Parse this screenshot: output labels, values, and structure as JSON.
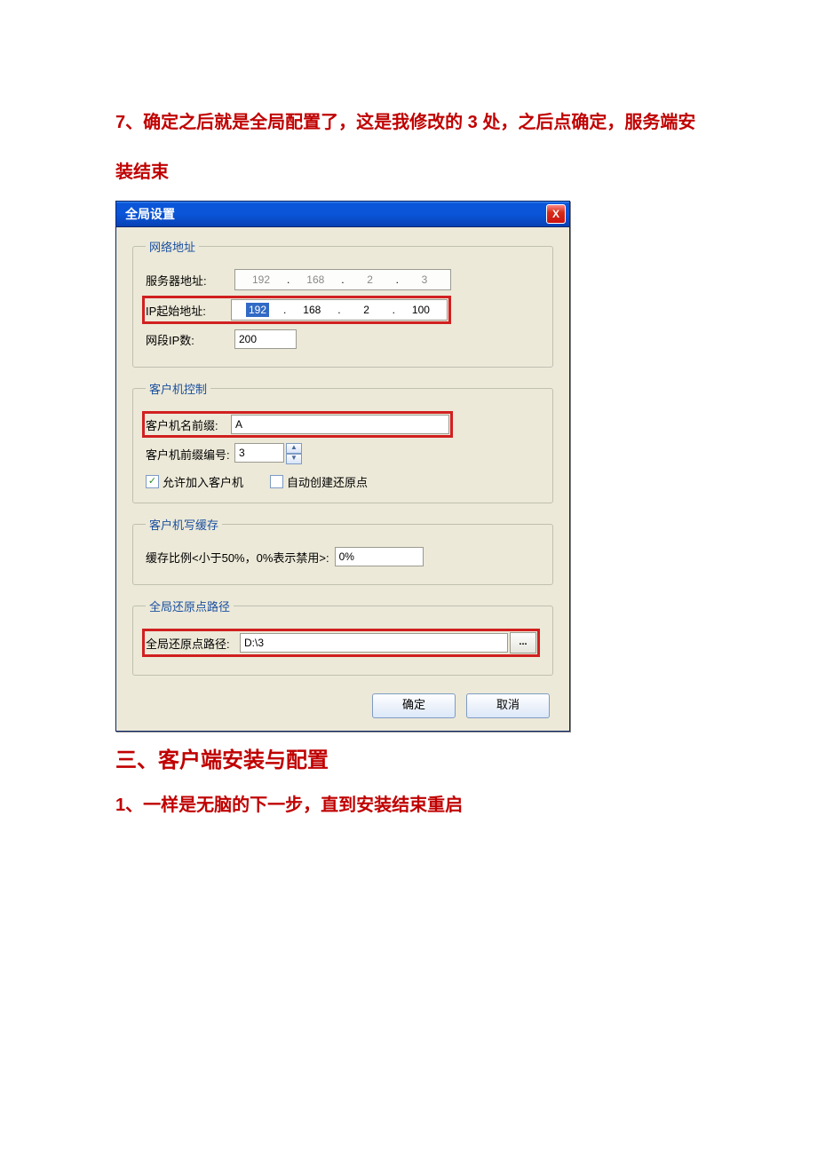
{
  "doc": {
    "para1": "7、确定之后就是全局配置了，这是我修改的 3 处，之后点确定，服务端安装结束",
    "section_heading": "三、客户端安装与配置",
    "para2": "1、一样是无脑的下一步，直到安装结束重启"
  },
  "dialog": {
    "title": "全局设置",
    "close": "X",
    "groups": {
      "network": {
        "legend": "网络地址",
        "server_label": "服务器地址:",
        "server_ip": [
          "192",
          "168",
          "2",
          "3"
        ],
        "start_label": "IP起始地址:",
        "start_ip": [
          "192",
          "168",
          "2",
          "100"
        ],
        "segcount_label": "网段IP数:",
        "segcount_value": "200"
      },
      "client": {
        "legend": "客户机控制",
        "prefix_label": "客户机名前缀:",
        "prefix_value": "A",
        "prefixnum_label": "客户机前缀编号:",
        "prefixnum_value": "3",
        "allow_join": "允许加入客户机",
        "auto_restore": "自动创建还原点"
      },
      "cache": {
        "legend": "客户机写缓存",
        "ratio_label": "缓存比例<小于50%，0%表示禁用>:",
        "ratio_value": "0%"
      },
      "restore": {
        "legend": "全局还原点路径",
        "path_label": "全局还原点路径:",
        "path_value": "D:\\3",
        "browse": "..."
      }
    },
    "buttons": {
      "ok": "确定",
      "cancel": "取消"
    }
  }
}
